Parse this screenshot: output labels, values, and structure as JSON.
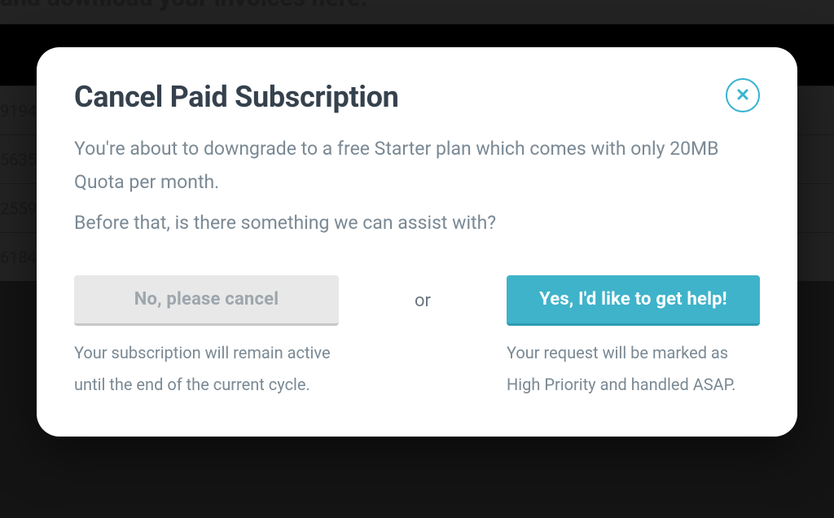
{
  "background": {
    "heading": "and download your invoices here.",
    "rows": [
      "9194",
      "5635",
      "2559",
      "6184"
    ]
  },
  "modal": {
    "title": "Cancel Paid Subscription",
    "body_p1": "You're about to downgrade to a free Starter plan which comes with only 20MB Quota per month.",
    "body_p2": "Before that, is there something we can assist with?",
    "or_label": "or",
    "cancel_button": "No, please cancel",
    "cancel_caption": "Your subscription will remain active until the end of the current cycle.",
    "help_button": "Yes, I'd like to get help!",
    "help_caption": "Your request will be marked as High Priority and handled ASAP."
  }
}
